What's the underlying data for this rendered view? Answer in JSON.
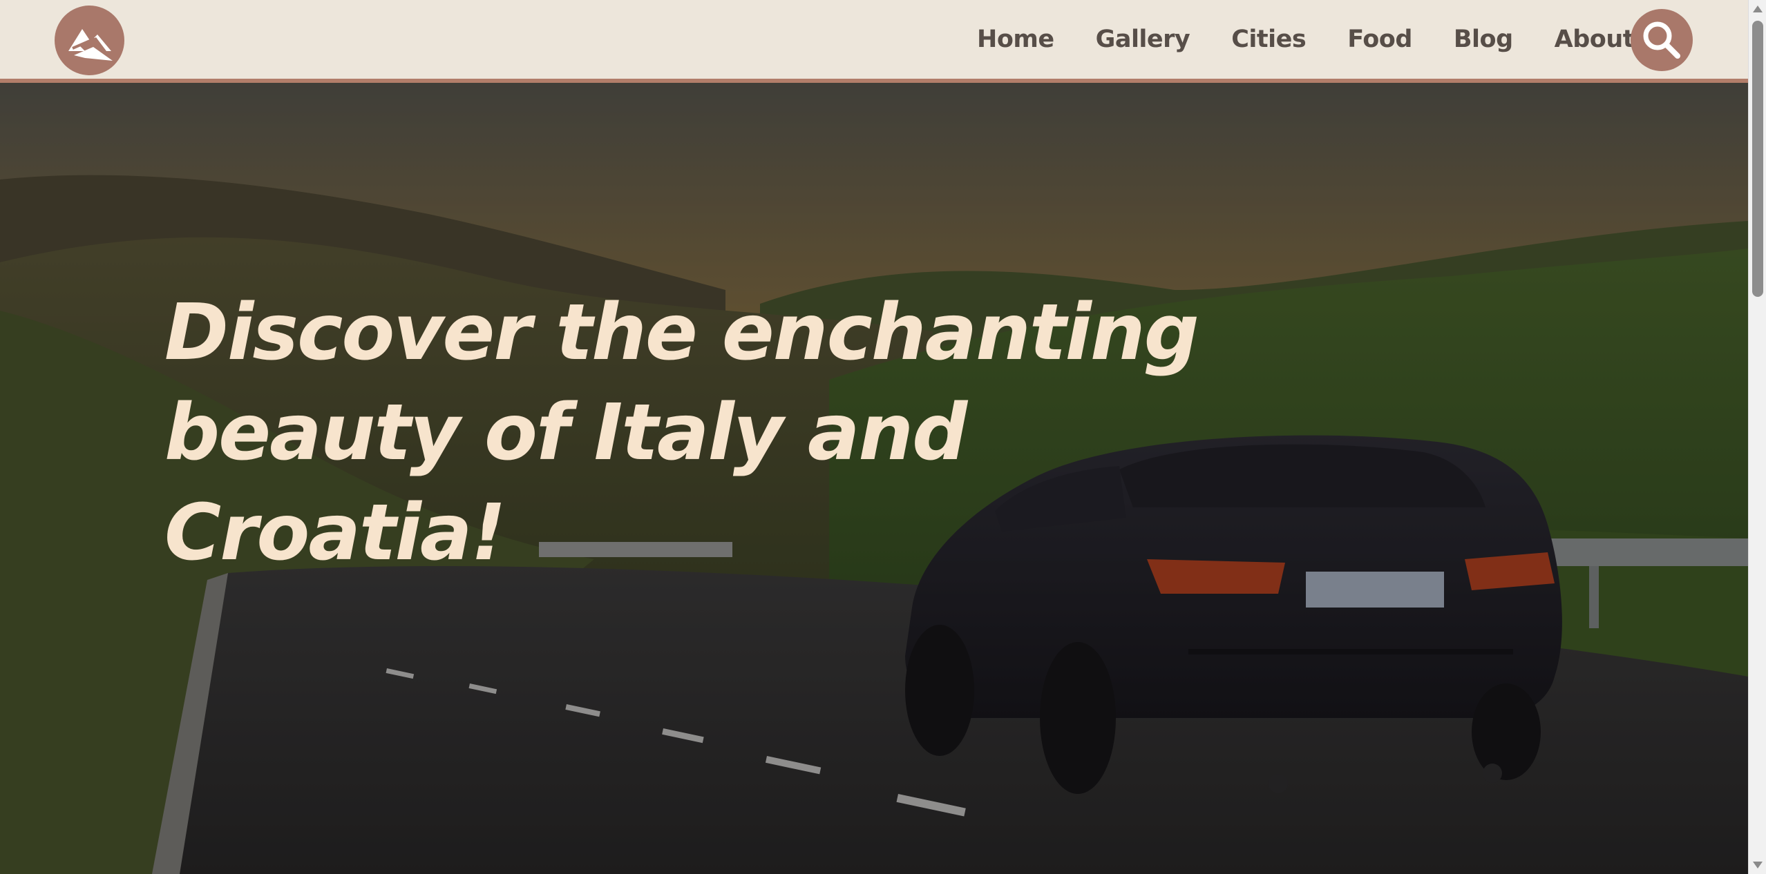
{
  "header": {
    "logo_name": "mountain-logo-icon",
    "nav": [
      {
        "label": "Home"
      },
      {
        "label": "Gallery"
      },
      {
        "label": "Cities"
      },
      {
        "label": "Food"
      },
      {
        "label": "Blog"
      },
      {
        "label": "About"
      }
    ],
    "search_icon": "search-icon"
  },
  "hero": {
    "title": "Discover the enchanting beauty of Italy and Croatia!"
  },
  "colors": {
    "header_bg": "#ede6db",
    "accent": "#a9786a",
    "nav_text": "#574e48",
    "hero_text": "#f7e4cd"
  }
}
